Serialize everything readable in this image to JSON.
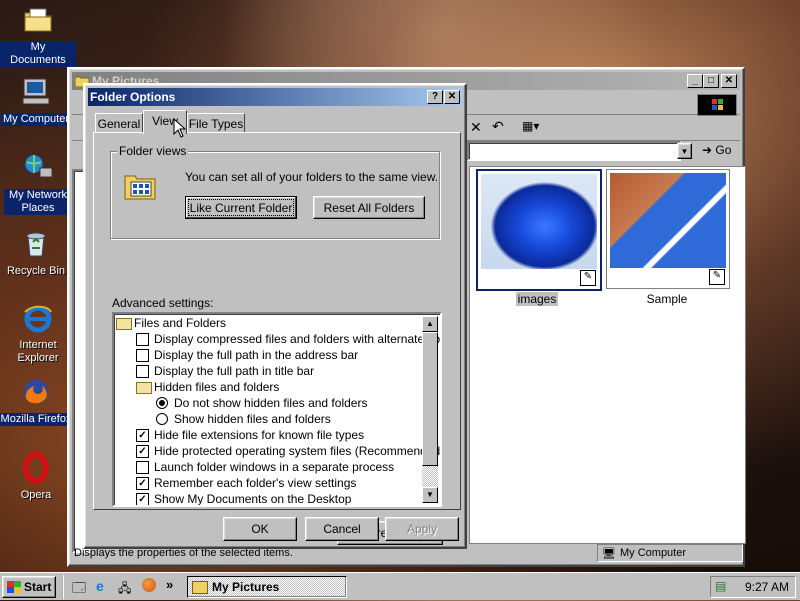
{
  "desktop": {
    "icons": [
      {
        "label": "My Documents",
        "icon": "folder-documents-icon"
      },
      {
        "label": "My Computer",
        "icon": "computer-icon"
      },
      {
        "label": "My Network Places",
        "icon": "network-icon"
      },
      {
        "label": "Recycle Bin",
        "icon": "recycle-bin-icon"
      },
      {
        "label": "Internet Explorer",
        "icon": "internet-explorer-icon"
      },
      {
        "label": "Mozilla Firefox",
        "icon": "firefox-icon"
      },
      {
        "label": "Opera",
        "icon": "opera-icon"
      }
    ]
  },
  "explorer": {
    "title": "My Pictures",
    "go_label": "Go",
    "files": [
      {
        "name": "images",
        "selected": true
      },
      {
        "name": "Sample",
        "selected": false
      }
    ],
    "status_left": "Displays the properties of the selected items.",
    "status_right": "My Computer"
  },
  "dialog": {
    "title": "Folder Options",
    "help": "?",
    "close": "✕",
    "tabs": [
      "General",
      "View",
      "File Types"
    ],
    "active_tab": "View",
    "folder_views": {
      "legend": "Folder views",
      "text": "You can set all of your folders to the same view.",
      "like_current": "Like Current Folder",
      "reset_all": "Reset All Folders"
    },
    "advanced_label": "Advanced settings:",
    "advanced_items": [
      {
        "kind": "folder",
        "indent": 0,
        "label": "Files and Folders"
      },
      {
        "kind": "check",
        "indent": 1,
        "checked": false,
        "label": "Display compressed files and folders with alternate color"
      },
      {
        "kind": "check",
        "indent": 1,
        "checked": false,
        "label": "Display the full path in the address bar"
      },
      {
        "kind": "check",
        "indent": 1,
        "checked": false,
        "label": "Display the full path in title bar"
      },
      {
        "kind": "folder",
        "indent": 1,
        "label": "Hidden files and folders"
      },
      {
        "kind": "radio",
        "indent": 2,
        "checked": true,
        "label": "Do not show hidden files and folders"
      },
      {
        "kind": "radio",
        "indent": 2,
        "checked": false,
        "label": "Show hidden files and folders"
      },
      {
        "kind": "check",
        "indent": 1,
        "checked": true,
        "label": "Hide file extensions for known file types"
      },
      {
        "kind": "check",
        "indent": 1,
        "checked": true,
        "label": "Hide protected operating system files (Recommended)"
      },
      {
        "kind": "check",
        "indent": 1,
        "checked": false,
        "label": "Launch folder windows in a separate process"
      },
      {
        "kind": "check",
        "indent": 1,
        "checked": true,
        "label": "Remember each folder's view settings"
      },
      {
        "kind": "check",
        "indent": 1,
        "checked": true,
        "label": "Show My Documents on the Desktop"
      }
    ],
    "restore_defaults": "Restore Defaults",
    "ok": "OK",
    "cancel": "Cancel",
    "apply": "Apply"
  },
  "taskbar": {
    "start": "Start",
    "task": "My Pictures",
    "quick_launch_more": "»",
    "clock": "9:27 AM"
  },
  "colors": {
    "title_active": "#0a246a",
    "title_inactive": "#808080",
    "face": "#c0c0c0"
  }
}
